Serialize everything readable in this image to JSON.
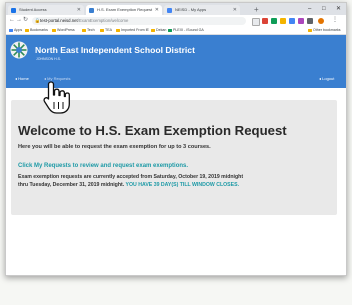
{
  "browser": {
    "tabs": [
      {
        "title": "Student Access",
        "color": "#1a73e8"
      },
      {
        "title": "H.S. Exam Exemption Request",
        "color": "#3a7fd0"
      },
      {
        "title": "NEISD - My Apps",
        "color": "#4285f4"
      }
    ],
    "new_tab": "+",
    "window_controls": {
      "minimize": "–",
      "maximize": "□",
      "close": "✕"
    },
    "url": {
      "domain": "test-portal.neisd.net",
      "path": "/ExamExemption/welcome"
    },
    "bookmarks": [
      {
        "label": "Apps",
        "color": "#4285f4"
      },
      {
        "label": "Bookmarks",
        "color": "#f4b400"
      },
      {
        "label": "WordPress",
        "color": "#f4b400"
      },
      {
        "label": "Tech",
        "color": "#f4b400"
      },
      {
        "label": "TEA",
        "color": "#f4b400"
      },
      {
        "label": "Imported From IE",
        "color": "#f4b400"
      },
      {
        "label": "Dekan",
        "color": "#f4b400"
      },
      {
        "label": "PLEXI - iSound GA",
        "color": "#0f9d58"
      },
      {
        "label": "Other bookmarks",
        "color": "#f4b400"
      }
    ]
  },
  "site": {
    "district_name": "North East Independent School District",
    "school_name": "JOHNSON H.S.",
    "nav": {
      "home": "◂ Home",
      "my_requests": "◂ My Requests",
      "logout": "◂ Logout"
    }
  },
  "main": {
    "heading": "Welcome to H.S. Exam Exemption Request",
    "subtitle": "Here you will be able to request the exam exemption for up to 3 courses.",
    "cta": "Click My Requests to review and request exam exemptions.",
    "notice_line1": "Exam exemption requests are currently accepted from Saturday, October 19, 2019 midnight",
    "notice_line2": "thru Tuesday, December 31, 2019 midnight.",
    "notice_highlight": "YOU HAVE 39 DAY(S) TILL WINDOW CLOSES."
  },
  "colors": {
    "header_bg": "#3a7fd0",
    "accent_teal": "#1e9aa6",
    "panel_bg": "#e9e9e9"
  }
}
